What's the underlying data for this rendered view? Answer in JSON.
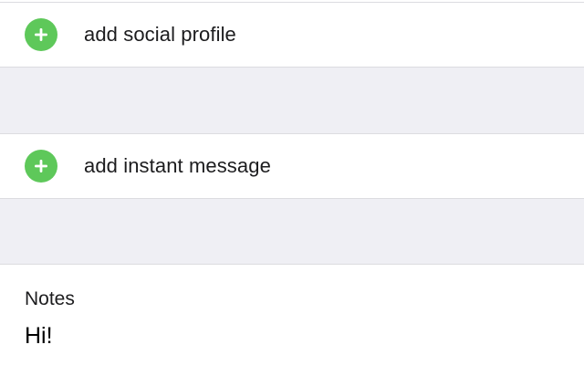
{
  "contact_editor": {
    "social_profile": {
      "label": "add social profile",
      "icon": "add-circle-icon",
      "icon_color": "#5ec85a"
    },
    "instant_message": {
      "label": "add instant message",
      "icon": "add-circle-icon",
      "icon_color": "#5ec85a"
    },
    "notes": {
      "label": "Notes",
      "value": "Hi!"
    }
  },
  "colors": {
    "group_background": "#efeff4",
    "cell_background": "#ffffff",
    "separator": "#dcdce0",
    "text": "#1c1c1e"
  }
}
